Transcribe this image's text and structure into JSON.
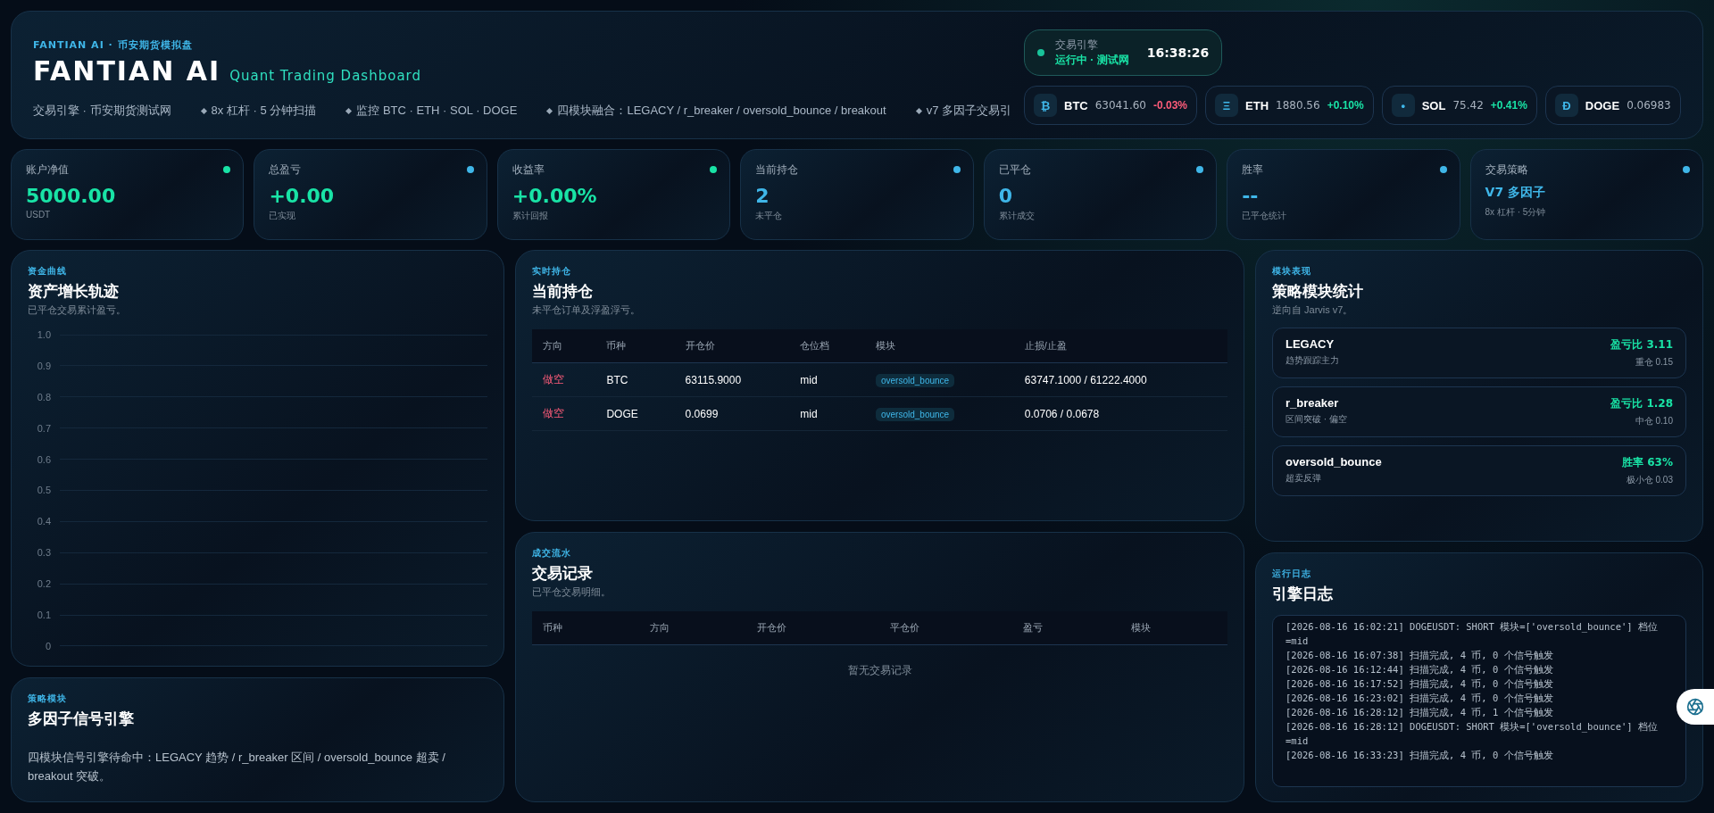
{
  "header": {
    "eyebrow": "FANTIAN AI · 币安期货模拟盘",
    "title": "FANTIAN AI",
    "subtitle": "Quant Trading Dashboard",
    "ticker": [
      "交易引擎 · 币安期货测试网",
      "8x 杠杆 · 5 分钟扫描",
      "监控 BTC · ETH · SOL · DOGE",
      "四模块融合：LEGACY / r_breaker / oversold_bounce / breakout",
      "v7 多因子交易引"
    ],
    "status": {
      "label": "交易引擎",
      "value": "运行中 · 测试网",
      "time": "16:38:26",
      "on": true
    },
    "coins": [
      {
        "symbol": "₿",
        "name": "BTC",
        "price": "63041.60",
        "change": "-0.03%",
        "up": false
      },
      {
        "symbol": "Ξ",
        "name": "ETH",
        "price": "1880.56",
        "change": "+0.10%",
        "up": true
      },
      {
        "symbol": "•",
        "name": "SOL",
        "price": "75.42",
        "change": "+0.41%",
        "up": true
      },
      {
        "symbol": "Ð",
        "name": "DOGE",
        "price": "0.06983"
      }
    ]
  },
  "stats": [
    {
      "label": "账户净值",
      "value": "5000.00",
      "sub": "USDT",
      "color": "#19e3a6",
      "kind": "number"
    },
    {
      "label": "总盈亏",
      "value": "+0.00",
      "sub": "已实现",
      "color": "#3fb6e8",
      "kind": "number"
    },
    {
      "label": "收益率",
      "value": "+0.00%",
      "sub": "累计回报",
      "color": "#19e3a6",
      "kind": "number"
    },
    {
      "label": "当前持仓",
      "value": "2",
      "sub": "未平仓",
      "color": "#3fb6e8",
      "kind": "count"
    },
    {
      "label": "已平仓",
      "value": "0",
      "sub": "累计成交",
      "color": "#3fb6e8",
      "kind": "count"
    },
    {
      "label": "胜率",
      "value": "--",
      "sub": "已平仓统计",
      "color": "#3fb6e8",
      "kind": "count"
    },
    {
      "label": "交易策略",
      "value": "V7 多因子",
      "sub": "8x 杠杆 · 5分钟",
      "color": "#3fb6e8",
      "kind": "text"
    }
  ],
  "equity": {
    "eyebrow": "资金曲线",
    "title": "资产增长轨迹",
    "desc": "已平仓交易累计盈亏。",
    "axis_labels": [
      "1.0",
      "0.9",
      "0.8",
      "0.7",
      "0.6",
      "0.5",
      "0.4",
      "0.3",
      "0.2",
      "0.1",
      "0"
    ]
  },
  "engine": {
    "eyebrow": "策略模块",
    "title": "多因子信号引擎",
    "text": "四模块信号引擎待命中：LEGACY 趋势 / r_breaker 区间 / oversold_bounce 超卖 / breakout 突破。"
  },
  "positions": {
    "eyebrow": "实时持仓",
    "title": "当前持仓",
    "desc": "未平仓订单及浮盈浮亏。",
    "columns": [
      "方向",
      "币种",
      "开仓价",
      "仓位档",
      "模块",
      "止损/止盈"
    ],
    "rows": [
      {
        "side": "做空",
        "short": true,
        "coin": "BTC",
        "entry": "63115.9000",
        "tier": "mid",
        "module": "oversold_bounce",
        "sltp": "63747.1000 / 61222.4000"
      },
      {
        "side": "做空",
        "short": true,
        "coin": "DOGE",
        "entry": "0.0699",
        "tier": "mid",
        "module": "oversold_bounce",
        "sltp": "0.0706 / 0.0678"
      }
    ]
  },
  "trades": {
    "eyebrow": "成交流水",
    "title": "交易记录",
    "desc": "已平仓交易明细。",
    "columns": [
      "币种",
      "方向",
      "开仓价",
      "平仓价",
      "盈亏",
      "模块"
    ],
    "empty": "暂无交易记录"
  },
  "modules": {
    "eyebrow": "模块表现",
    "title": "策略模块统计",
    "desc": "逆向自 Jarvis v7。",
    "items": [
      {
        "name": "LEGACY",
        "desc": "趋势跟踪主力",
        "metric": "盈亏比 3.11",
        "sub": "重仓 0.15"
      },
      {
        "name": "r_breaker",
        "desc": "区间突破 · 偏空",
        "metric": "盈亏比 1.28",
        "sub": "中仓 0.10"
      },
      {
        "name": "oversold_bounce",
        "desc": "超卖反弹",
        "metric": "胜率 63%",
        "sub": "极小仓 0.03"
      }
    ]
  },
  "logs": {
    "eyebrow": "运行日志",
    "title": "引擎日志",
    "lines": [
      "[2026-08-16 16:02:21]   DOGEUSDT: SHORT 模块=['oversold_bounce'] 档位=mid",
      "[2026-08-16 16:07:38] 扫描完成, 4 币, 0 个信号触发",
      "[2026-08-16 16:12:44] 扫描完成, 4 币, 0 个信号触发",
      "[2026-08-16 16:17:52] 扫描完成, 4 币, 0 个信号触发",
      "[2026-08-16 16:23:02] 扫描完成, 4 币, 0 个信号触发",
      "[2026-08-16 16:28:12] 扫描完成, 4 币, 1 个信号触发",
      "[2026-08-16 16:28:12]   DOGEUSDT: SHORT 模块=['oversold_bounce'] 档位=mid",
      "[2026-08-16 16:33:23] 扫描完成, 4 币, 0 个信号触发"
    ]
  }
}
